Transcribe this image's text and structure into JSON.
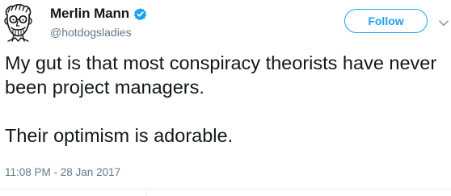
{
  "author": {
    "display_name": "Merlin Mann",
    "handle": "@hotdogsladies",
    "avatar_icon": "caricature-avatar-icon",
    "verified_icon": "verified-badge-icon"
  },
  "actions": {
    "follow_label": "Follow",
    "menu_icon": "chevron-down-icon"
  },
  "tweet": {
    "line_1": "My gut is that most conspiracy theorists have never been project managers.",
    "line_2": "Their optimism is adorable.",
    "timestamp": "11:08 PM - 28 Jan 2017"
  },
  "colors": {
    "accent": "#1da1f2",
    "text": "#14171a",
    "secondary_text": "#657786",
    "divider": "#e6ecf0"
  }
}
